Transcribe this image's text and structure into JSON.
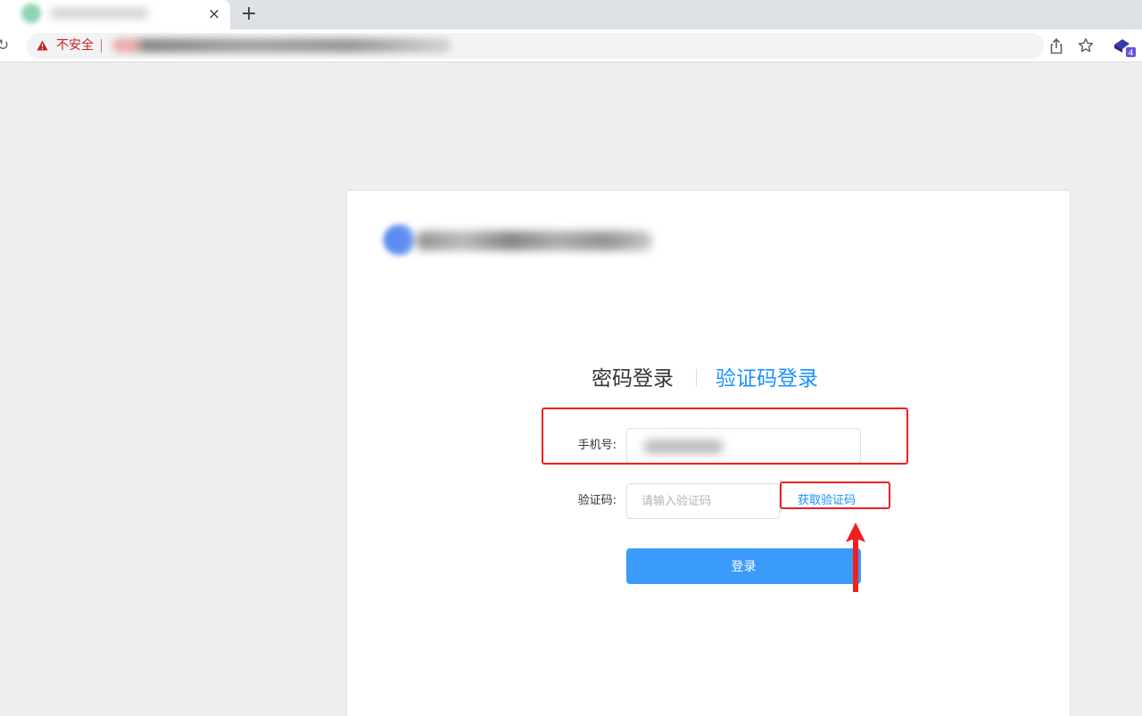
{
  "browser": {
    "tab": {
      "close_glyph": "×",
      "favicon_icon": "site-favicon-icon"
    },
    "new_tab_glyph": "+",
    "reload_glyph": "↻",
    "omnibox": {
      "security_label": "不安全",
      "warning_icon": "warning-triangle-icon"
    },
    "toolbar_icons": [
      "share-icon",
      "star-icon",
      "extension-icon"
    ],
    "extension_badge": "4"
  },
  "login": {
    "tabs": {
      "password_login": "密码登录",
      "code_login": "验证码登录",
      "active": "code_login"
    },
    "phone": {
      "label": "手机号:"
    },
    "code": {
      "label": "验证码:",
      "placeholder": "请输入验证码",
      "get_code_link": "获取验证码"
    },
    "submit_label": "登录"
  },
  "colors": {
    "accent": "#1890ff",
    "button": "#3a9bfa",
    "annotation": "#ee2020",
    "insecure": "#c5221f"
  }
}
